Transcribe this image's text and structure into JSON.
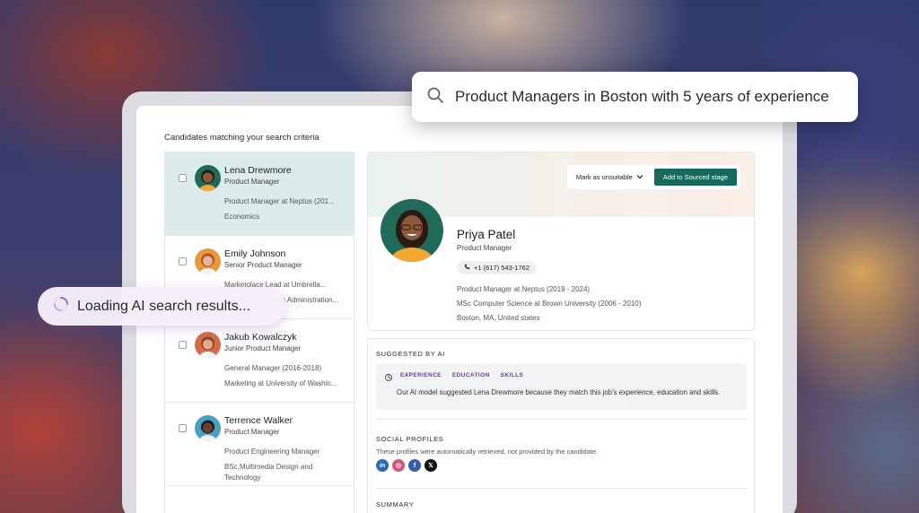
{
  "search": {
    "query": "Product Managers in Boston with 5 years of experience"
  },
  "loading": {
    "text": "Loading AI search results..."
  },
  "page": {
    "title": "Candidates matching your search criteria"
  },
  "candidates": [
    {
      "name": "Lena Drewmore",
      "role": "Product Manager",
      "line1": "Product Manager at Neptus (201...",
      "line2": "Economics",
      "selected": true,
      "skin": "#8a5a3c",
      "hair": "#2b1a12",
      "bg": "#1f6a58"
    },
    {
      "name": "Emily Johnson",
      "role": "Senior Product Manager",
      "line1": "Marketolace Lead at Umbrella...",
      "line2": "Master of Business Administration...",
      "selected": false,
      "skin": "#e8b59a",
      "hair": "#b5502a",
      "bg": "#e79a3a"
    },
    {
      "name": "Jakub Kowalczyk",
      "role": "Junior Product Manager",
      "line1": "General Manager (2016-2018)",
      "line2": "Marketing at University of Washin...",
      "selected": false,
      "skin": "#e2a98a",
      "hair": "#7a4a2a",
      "bg": "#d86a4a"
    },
    {
      "name": "Terrence Walker",
      "role": "Product Manager",
      "line1": "Product Engineering Manager",
      "line2": "BSc,Multimedia Design and Technology",
      "selected": false,
      "skin": "#6a4030",
      "hair": "#1a1a1a",
      "bg": "#4aa0c0"
    }
  ],
  "actions": {
    "mark_label": "Mark as unsuitable",
    "add_label": "Add to Sourced stage"
  },
  "profile": {
    "name": "Priya Patel",
    "role": "Product Manager",
    "phone": "+1 (617) 543-1762",
    "line1": "Product Manager at Neptus (2019 - 2024)",
    "line2": "MSc Computer Science at Brown University (2006 - 2010)",
    "line3": "Boston, MA, United states"
  },
  "suggestion": {
    "title": "SUGGESTED BY AI",
    "tags": [
      "EXPERIENCE",
      "EDUCATION",
      "SKILLS"
    ],
    "text": "Our AI model suggested Lena Drewmore because they match this job's experience, education and skills."
  },
  "social": {
    "title": "SOCIAL PROFILES",
    "subtitle": "These profiles were automatically retrieved, not provided by the candidate.",
    "icons": [
      {
        "name": "linkedin-icon",
        "glyph": "in",
        "color": "#2a6ab0"
      },
      {
        "name": "dribbble-icon",
        "glyph": "◎",
        "color": "#d6557e"
      },
      {
        "name": "facebook-icon",
        "glyph": "f",
        "color": "#3b5ba8"
      },
      {
        "name": "x-icon",
        "glyph": "𝕏",
        "color": "#111111"
      }
    ]
  },
  "summary": {
    "title": "SUMMARY"
  },
  "colors": {
    "accent": "#166a5c",
    "selected_row": "#dcecea",
    "tag": "#6b3fa0"
  }
}
